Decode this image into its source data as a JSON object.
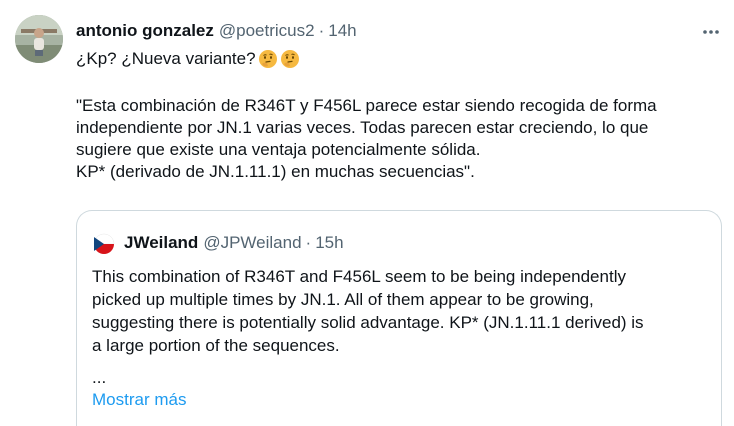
{
  "tweet": {
    "display_name": "antonio gonzalez",
    "handle": "@poetricus2",
    "separator": "·",
    "time": "14h",
    "text_line1": "¿Kp? ¿Nueva variante?",
    "emojis": [
      "thinking-face-emoji",
      "thinking-face-emoji"
    ],
    "quote_lines": [
      "\"Esta combinación de R346T y F456L parece estar siendo recogida de forma",
      "independiente por JN.1 varias veces. Todas parecen estar creciendo, lo que",
      "sugiere que existe una ventaja potencialmente sólida.",
      "KP* (derivado de JN.1.11.1) en muchas secuencias\"."
    ],
    "more_icon": "more-horizontal-icon"
  },
  "quoted": {
    "display_name": "JWeiland",
    "handle": "@JPWeiland",
    "separator": "·",
    "time": "15h",
    "lines": [
      "This combination of R346T and F456L seem to be being independently",
      "picked up multiple times by JN.1.  All of them appear to be growing,",
      "suggesting there is potentially solid advantage.  KP* (JN.1.11.1 derived) is",
      "a large portion of the sequences."
    ],
    "ellipsis": "...",
    "show_more": "Mostrar más"
  },
  "colors": {
    "text": "#0f1419",
    "secondary": "#536471",
    "link": "#1d9bf0",
    "border": "#cfd9de",
    "emoji": "#f6b940"
  }
}
